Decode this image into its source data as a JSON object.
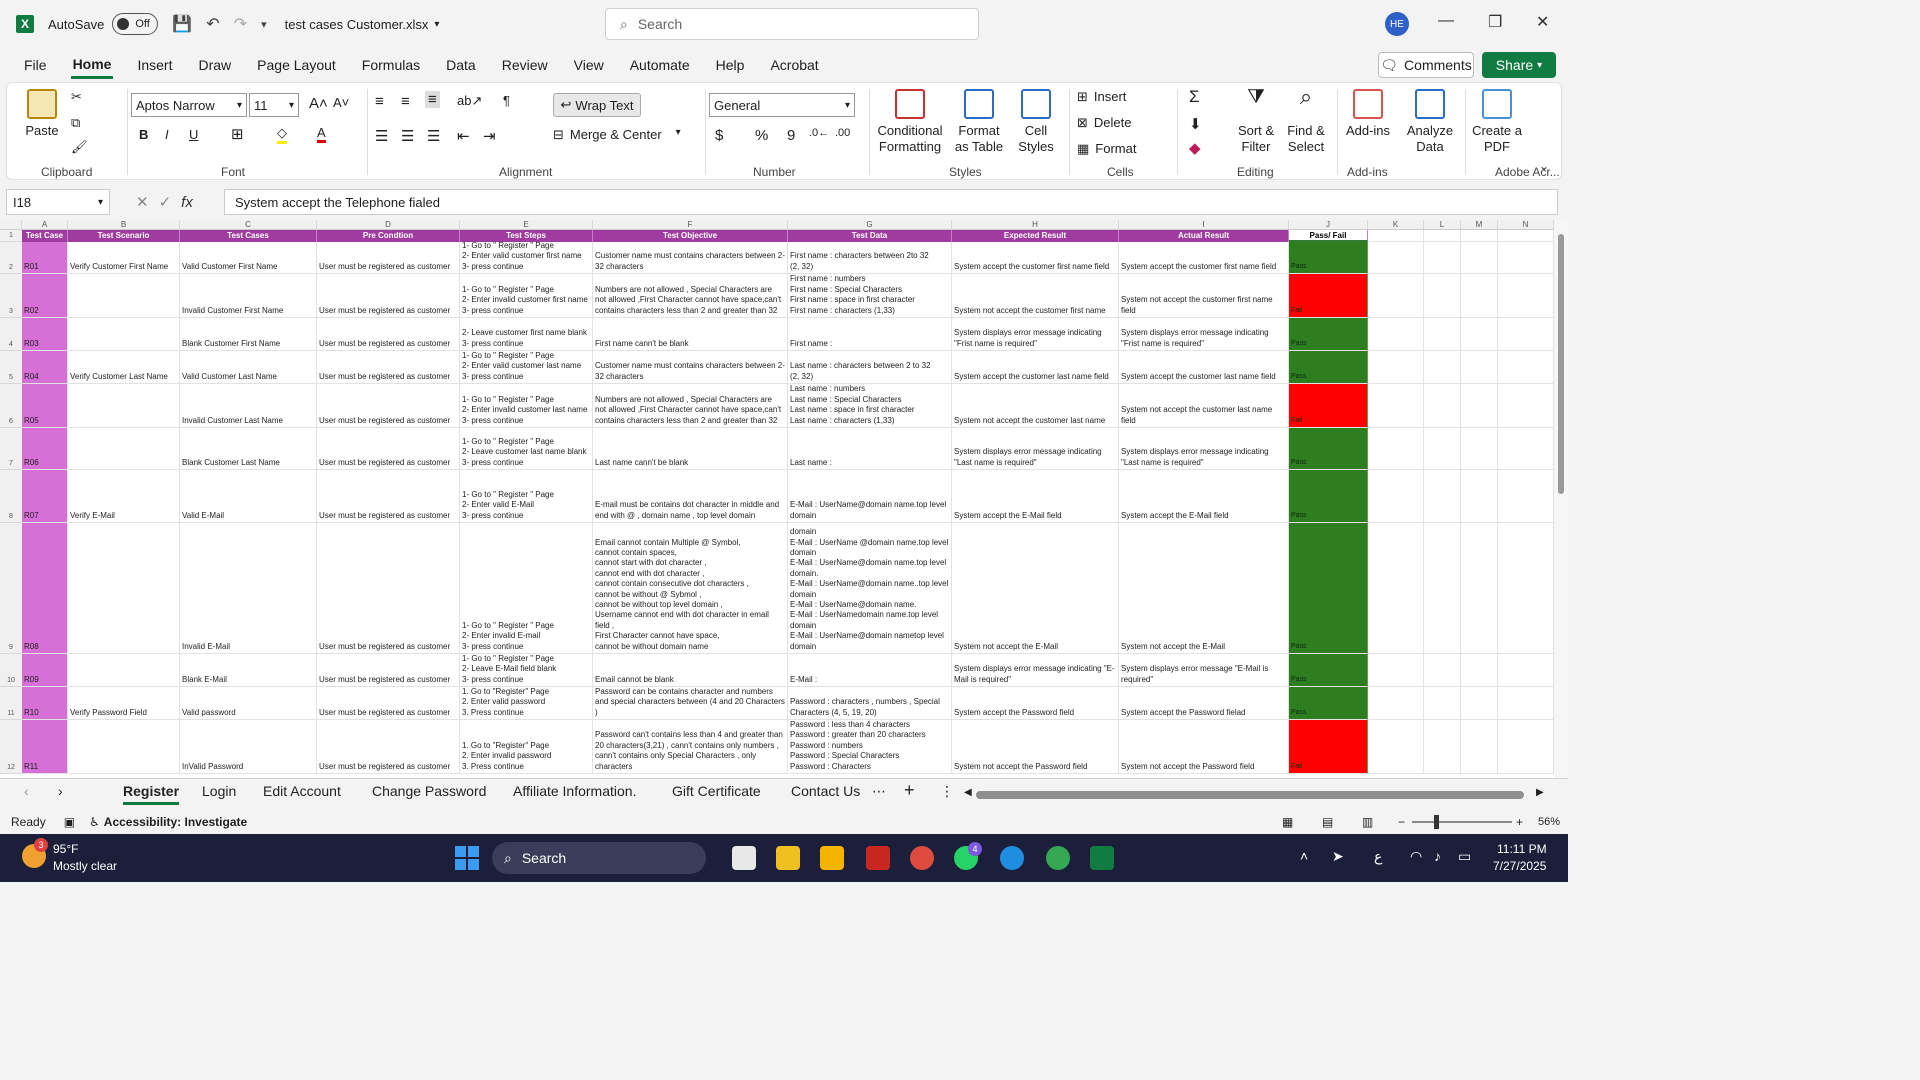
{
  "titlebar": {
    "autosave_label": "AutoSave",
    "toggle_state": "Off",
    "filename": "test cases Customer.xlsx",
    "search_placeholder": "Search",
    "avatar_initials": "HE"
  },
  "menu": {
    "items": [
      "File",
      "Home",
      "Insert",
      "Draw",
      "Page Layout",
      "Formulas",
      "Data",
      "Review",
      "View",
      "Automate",
      "Help",
      "Acrobat"
    ],
    "active": "Home",
    "comments_label": "Comments",
    "share_label": "Share"
  },
  "ribbon": {
    "clipboard": {
      "paste": "Paste",
      "label": "Clipboard"
    },
    "font": {
      "name": "Aptos Narrow",
      "size": "11",
      "label": "Font"
    },
    "alignment": {
      "wrap_text": "Wrap Text",
      "merge_center": "Merge & Center",
      "label": "Alignment"
    },
    "number": {
      "format": "General",
      "label": "Number"
    },
    "styles": {
      "conditional": "Conditional Formatting",
      "format_table": "Format as Table",
      "cell_styles": "Cell Styles",
      "label": "Styles"
    },
    "cells": {
      "insert": "Insert",
      "delete": "Delete",
      "format": "Format",
      "label": "Cells"
    },
    "editing": {
      "sort_filter": "Sort & Filter",
      "find_select": "Find & Select",
      "label": "Editing"
    },
    "addins": {
      "addins": "Add-ins",
      "analyze": "Analyze Data",
      "label": "Add-ins"
    },
    "acrobat": {
      "create_pdf": "Create a PDF",
      "label": "Adobe Acr..."
    }
  },
  "formula_bar": {
    "name_box": "I18",
    "formula": "System accept the Telephone fialed"
  },
  "columns": [
    "A",
    "B",
    "C",
    "D",
    "E",
    "F",
    "G",
    "H",
    "I",
    "J",
    "K",
    "L",
    "M",
    "N"
  ],
  "headers": [
    "Test Case",
    "Test Scenario",
    "Test Cases",
    "Pre Condtion",
    "Test Steps",
    "Test Objective",
    "Test Data",
    "Expected Result",
    "Actual Result",
    "Pass/ Fail"
  ],
  "rows": [
    {
      "num": "1",
      "cells": []
    },
    {
      "num": "2",
      "status": "pass",
      "cells": [
        "R01",
        "Verify Customer First Name",
        "Valid Customer First Name",
        "User must be registered as customer",
        "1- Go to \" Register \" Page\n2- Enter valid customer first name\n3- press continue",
        "Customer name must contains characters between 2-32 characters",
        "First name : characters between 2to 32\n(2, 32)",
        "System accept the customer first name field",
        "System accept the customer first name field",
        "Pass"
      ]
    },
    {
      "num": "3",
      "status": "fail",
      "cells": [
        "R02",
        "",
        "Invalid Customer First Name",
        "User must be registered as customer",
        "1- Go to \" Register \" Page\n2- Enter invalid customer first name\n3- press continue",
        "Numbers are not allowed , Special Characters are not allowed ,First Character cannot have space,can't contains characters less than 2 and greater than 32",
        "First name : numbers\nFirst name : Special Characters\nFirst name : space in first character\nFirst name : characters (1,33)",
        "System not accept the customer first name",
        "System not accept the customer first name field",
        "Fail"
      ]
    },
    {
      "num": "4",
      "status": "pass",
      "cells": [
        "R03",
        "",
        "Blank Customer First Name",
        "User must be registered as customer",
        "2- Leave customer first name blank\n3- press continue",
        "First name cann't be blank",
        "First name :",
        "System displays error message indicating \"Frist name is required\"",
        "System displays error message indicating \"Frist name is required\"",
        "Pass"
      ]
    },
    {
      "num": "5",
      "status": "pass",
      "cells": [
        "R04",
        "Verify Customer Last Name",
        "Valid Customer Last Name",
        "User must be registered as customer",
        "1- Go to \" Register \" Page\n2- Enter valid customer last name\n3- press continue",
        "Customer name must contains characters between 2-32 characters",
        "Last name : characters between 2 to 32\n(2, 32)",
        "System accept the customer last name field",
        "System accept the customer last name field",
        "Pass"
      ]
    },
    {
      "num": "6",
      "status": "fail",
      "cells": [
        "R05",
        "",
        "Invalid Customer Last Name",
        "User must be registered as customer",
        "1- Go to \" Register \" Page\n2- Enter invalid customer last name\n3- press continue",
        "Numbers are not allowed , Special Characters are not allowed ,First Character cannot have space,can't contains characters less than 2 and greater than 32",
        "Last name : numbers\nLast name : Special Characters\nLast name : space in first character\nLast name : characters (1,33)",
        "System not accept the customer last name",
        "System not accept the customer last name field",
        "Fail"
      ]
    },
    {
      "num": "7",
      "status": "pass",
      "cells": [
        "R06",
        "",
        "Blank Customer Last Name",
        "User must be registered as customer",
        "1- Go to \" Register \" Page\n2- Leave customer last name blank\n3- press continue",
        "Last name cann't be blank",
        "Last name :",
        "System displays error message indicating \"Last name is required\"",
        "System displays error message indicating \"Last name is required\"",
        "Pass"
      ]
    },
    {
      "num": "8",
      "status": "pass",
      "cells": [
        "R07",
        "Verify E-Mail",
        "Valid E-Mail",
        "User must be registered as customer",
        "1- Go to \" Register \" Page\n2- Enter valid E-Mail\n3- press continue",
        "E-mail must be contains dot character in middle and end with @ , domain name , top level domain",
        "E-Mail : UserName@domain name.top level domain",
        "System accept the E-Mail field",
        "System accept the E-Mail field",
        "Pass"
      ]
    },
    {
      "num": "9",
      "status": "pass",
      "cells": [
        "R08",
        "",
        "Invalid E-Mail",
        "User must be registered as customer",
        "1- Go to \" Register \" Page\n2- Enter invalid E-mail\n3- press continue",
        "Email cannot contain Multiple @ Symbol,\ncannot contain spaces,\ncannot start with dot character ,\ncannot end with dot character ,\ncannot contain consecutive dot characters ,\ncannot be without @ Sybmol ,\ncannot be without top level domain ,\nUsername cannot end with dot character in email field ,\nFirst Character cannot have space,\ncannot be without domain name",
        "domain\nE-Mail : UserName @domain name.top level domain\nE-Mail : UserName@domain name.top level domain.\nE-Mail : UserName@domain name..top level domain\nE-Mail : UserName@domain name.\nE-Mail : UserNamedomain name.top level domain\nE-Mail : UserName@domain nametop level domain",
        "System not accept the E-Mail",
        "System not accept the E-Mail",
        "Pass"
      ]
    },
    {
      "num": "10",
      "status": "pass",
      "cells": [
        "R09",
        "",
        "Blank E-Mail",
        "User must be registered as customer",
        "1- Go to \" Register \" Page\n2- Leave E-Mail field blank\n3- press continue",
        "Email cannot be blank",
        "E-Mail :",
        "System displays error message indicating \"E-Mail is required\"",
        "System displays error message \"E-Mail is required\"",
        "Pass"
      ]
    },
    {
      "num": "11",
      "status": "pass",
      "cells": [
        "R10",
        "Verify Password Field",
        "Valid password",
        "User must be registered as customer",
        "1. Go to \"Register\" Page\n2. Enter valid password\n3. Press continue",
        "Password can be contains character and numbers and special characters between (4 and 20 Characters )",
        "Password : characters , numbers , Special Characters (4, 5, 19, 20)",
        "System accept the Password field",
        "System accept the Password fielad",
        "Pass"
      ]
    },
    {
      "num": "12",
      "status": "fail",
      "cells": [
        "R11",
        "",
        "InValid Password",
        "User must be registered as customer",
        "1. Go to \"Register\" Page\n2. Enter invalid password\n3. Press continue",
        "Password can't contains less than 4 and greater than 20 characters(3,21) , cann't contains only numbers , cann't contains only Special Characters , only characters",
        "Password : less than 4 characters\nPassword : greater than 20 characters\nPassword : numbers\nPassword : Special Characters\nPassword : Characters",
        "System not accept the Password field",
        "System not accept the Password field",
        "Fail"
      ]
    }
  ],
  "sheet_tabs": [
    "Register",
    "Login",
    "Edit Account",
    "Change Password",
    "Affiliate Information.",
    "Gift Certificate",
    "Contact Us"
  ],
  "active_sheet": "Register",
  "status": {
    "ready": "Ready",
    "accessibility": "Accessibility: Investigate",
    "zoom": "56%"
  },
  "taskbar": {
    "temperature": "95°F",
    "weather": "Mostly clear",
    "search_label": "Search",
    "notification_count": "3",
    "whatsapp_badge": "4",
    "time": "11:11 PM",
    "date": "7/27/2025"
  },
  "colors": {
    "pass": "#2e7d1f",
    "fail": "#ff0000",
    "header": "#a03ca0",
    "col_a": "#d66fd6",
    "accent": "#107c41"
  }
}
